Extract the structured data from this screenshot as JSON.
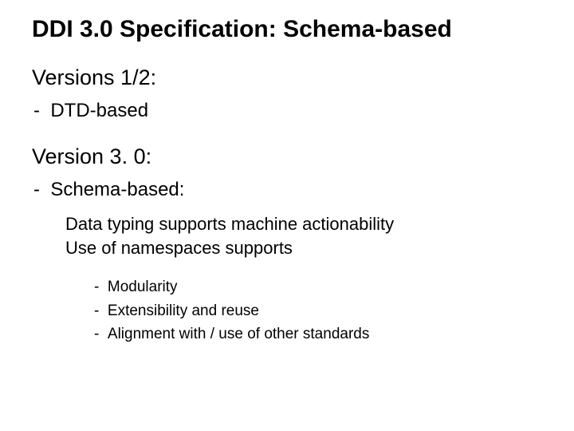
{
  "title": "DDI 3.0 Specification: Schema-based",
  "sections": [
    {
      "heading": "Versions 1/2:",
      "bullets": [
        {
          "text": "DTD-based",
          "subpoints": [],
          "nested": []
        }
      ]
    },
    {
      "heading": "Version 3. 0:",
      "bullets": [
        {
          "text": "Schema-based:",
          "subpoints": [
            "Data typing supports machine actionability",
            "Use of namespaces supports"
          ],
          "nested": [
            "Modularity",
            "Extensibility and reuse",
            "Alignment with / use of other standards"
          ]
        }
      ]
    }
  ],
  "dash": "-"
}
